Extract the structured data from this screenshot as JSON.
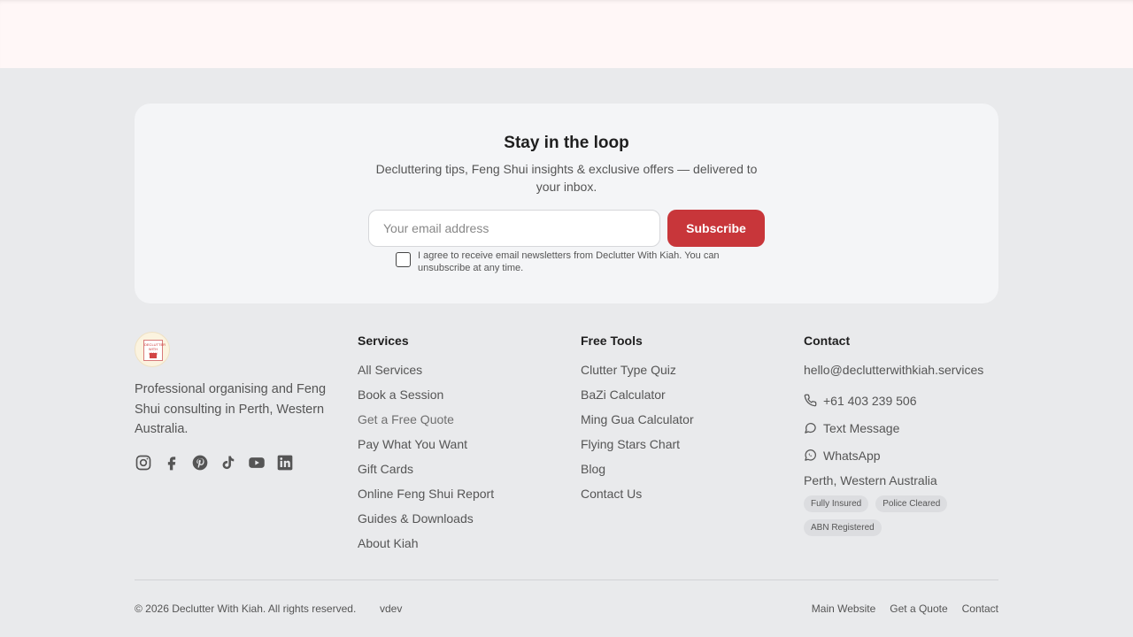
{
  "newsletter": {
    "title": "Stay in the loop",
    "subtitle": "Decluttering tips, Feng Shui insights & exclusive offers — delivered to your inbox.",
    "email_placeholder": "Your email address",
    "subscribe_label": "Subscribe",
    "consent_text": "I agree to receive email newsletters from Declutter With Kiah. You can unsubscribe at any time."
  },
  "brand": {
    "logo_text": "DECLUTTER WITH KIAH",
    "description": "Professional organising and Feng Shui consulting in Perth, Western Australia.",
    "socials": [
      "instagram-icon",
      "facebook-icon",
      "pinterest-icon",
      "tiktok-icon",
      "youtube-icon",
      "linkedin-icon"
    ]
  },
  "services": {
    "title": "Services",
    "items": [
      "All Services",
      "Book a Session",
      "Get a Free Quote",
      "Pay What You Want",
      "Gift Cards",
      "Online Feng Shui Report",
      "Guides & Downloads",
      "About Kiah"
    ]
  },
  "tools": {
    "title": "Free Tools",
    "items": [
      "Clutter Type Quiz",
      "BaZi Calculator",
      "Ming Gua Calculator",
      "Flying Stars Chart",
      "Blog",
      "Contact Us"
    ]
  },
  "contact": {
    "title": "Contact",
    "email": "hello@declutterwithkiah.services",
    "phone": "+61 403 239 506",
    "text_message": "Text Message",
    "whatsapp": "WhatsApp",
    "location": "Perth, Western Australia",
    "badges": [
      "Fully Insured",
      "Police Cleared",
      "ABN Registered"
    ]
  },
  "footer": {
    "copyright": "© 2026 Declutter With Kiah. All rights reserved.",
    "vdev": "vdev",
    "links": [
      "Main Website",
      "Get a Quote",
      "Contact"
    ]
  },
  "colors": {
    "accent": "#c8363a",
    "page_bg": "#e9eaec",
    "card_bg": "#f4f5f7"
  }
}
